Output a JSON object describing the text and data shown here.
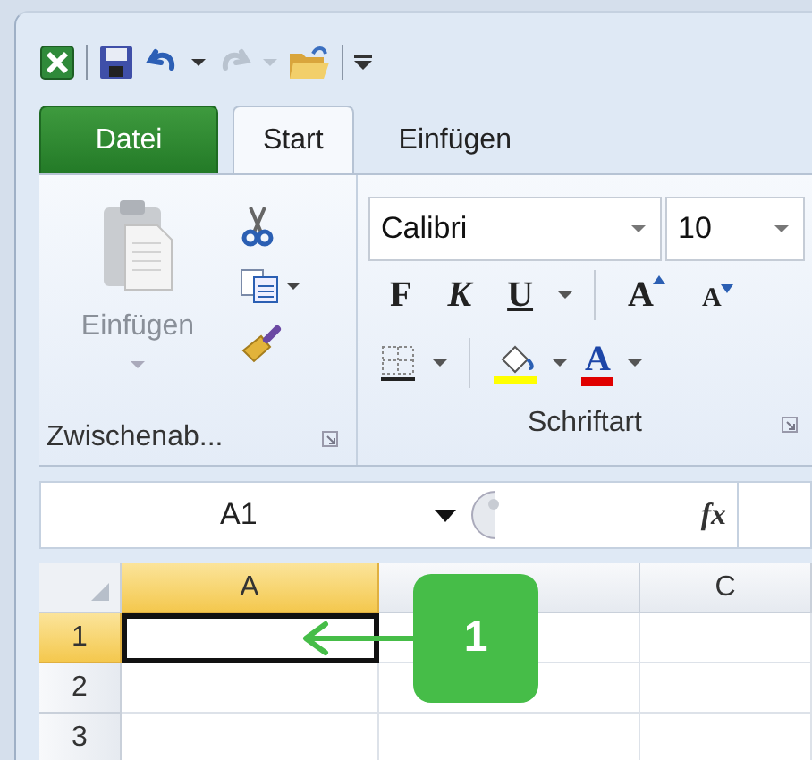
{
  "quick_access": [
    {
      "kind": "undo",
      "disabled": false
    },
    {
      "kind": "redo",
      "disabled": true
    }
  ],
  "tabs": [
    {
      "label": "Datei",
      "kind": "file",
      "selected": false
    },
    {
      "label": "Start",
      "kind": "tab",
      "selected": true
    },
    {
      "label": "Einfügen",
      "kind": "tab",
      "selected": false
    }
  ],
  "clipboard": {
    "paste_label": "Einfügen",
    "paste_disabled": true,
    "group_label": "Zwischenab..."
  },
  "font": {
    "font_name": "Calibri",
    "font_size": "10",
    "style_buttons": [
      {
        "label": "F",
        "kind": "bold"
      },
      {
        "label": "K",
        "kind": "italic"
      },
      {
        "label": "U",
        "kind": "underline"
      }
    ],
    "size_buttons": [
      {
        "label": "A",
        "kind": "grow"
      },
      {
        "label": "A",
        "kind": "shrink"
      }
    ],
    "font_color": {
      "label": "A",
      "color": "#e00000"
    },
    "group_label": "Schriftart"
  },
  "formula_bar": {
    "name_box": "A1",
    "function_label": "fx"
  },
  "columns": [
    {
      "label": "A",
      "selected": true
    },
    {
      "selected": false
    },
    {
      "label": "C",
      "selected": false
    }
  ],
  "rows": [
    {
      "label": "1",
      "selected": true
    },
    {
      "label": "2",
      "selected": false
    },
    {
      "label": "3",
      "selected": false
    }
  ],
  "callout": {
    "label": "1"
  }
}
